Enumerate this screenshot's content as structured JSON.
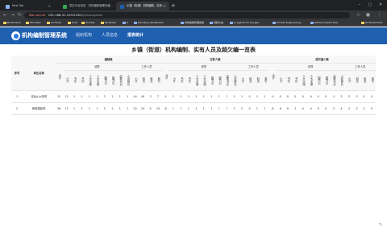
{
  "browser": {
    "tabs": [
      {
        "title": "New Tab",
        "active": false,
        "favicon_color": "#8ab4f8"
      },
      {
        "title": "党办平台信息 - 机构编制管理系统",
        "active": false,
        "favicon_color": "#34a853"
      },
      {
        "title": "乡镇（街道）机构编制、实有...",
        "active": true,
        "favicon_color": "#1f5fb0"
      }
    ],
    "new_tab": "+",
    "window_controls": [
      "–",
      "▢",
      "✕"
    ],
    "security_label": "Not secure",
    "url_host": "192.168.31.193:5190",
    "url_path": "/tjs/xiangzhen",
    "bookmarks": [
      {
        "label": "Bookmarks",
        "folder": true
      },
      {
        "label": "Favorites",
        "folder": true
      },
      {
        "label": "Archives",
        "folder": true
      },
      {
        "label": "tools",
        "folder": true
      },
      {
        "label": "Zombie",
        "folder": true
      },
      {
        "label": "Facebook",
        "folder": true
      },
      {
        "label": "Z",
        "folder": false
      },
      {
        "label": "Deciding repositories",
        "folder": false
      },
      {
        "label": "机构编制管理系统",
        "folder": false
      },
      {
        "label": "视频小站",
        "folder": false
      },
      {
        "label": "ai agents for Google...",
        "folder": false
      },
      {
        "label": "Prompt Engineering...",
        "folder": false
      },
      {
        "label": "GitHub Copilot Sea...",
        "folder": false
      }
    ],
    "all_bookmarks": "All Bookmarks"
  },
  "app": {
    "title": "机构编制管理系统",
    "menu": [
      {
        "label": "组织机构",
        "active": false
      },
      {
        "label": "人员信息",
        "active": false
      },
      {
        "label": "报表统计",
        "active": true
      }
    ]
  },
  "report": {
    "title": "乡镇（街道）机构编制、实有人员及超欠编一览表",
    "headers": {
      "seq": "序号",
      "unit": "单位名称",
      "groups": [
        "编制数",
        "在职人数",
        "超欠编人数"
      ],
      "leader": "领导",
      "staff": "工作人员",
      "total": "合计",
      "small": "小计",
      "leader_cols": [
        "书记",
        "人大主席",
        "副书记",
        "纪委书记",
        "人武部长"
      ],
      "staff_cols": [
        "小计",
        "科员",
        "其它"
      ]
    },
    "rows": [
      {
        "seq": "1",
        "name": "佳龙乡乡政府",
        "bz": [
          "12",
          "12",
          "1",
          "1",
          "1",
          "1",
          "2",
          "1",
          "1",
          "1",
          "44",
          "40",
          "3",
          "7"
        ],
        "zz": [
          "4",
          "1",
          "1",
          "1",
          "1",
          "1",
          "1",
          "1",
          "1",
          "1",
          "1",
          "0",
          "1",
          "1"
        ],
        "cq": [
          "-4",
          "-4",
          "0",
          "0",
          "0",
          "-4",
          "0",
          "0",
          "-1",
          "-3",
          "-3",
          "-3",
          "0",
          "0"
        ]
      },
      {
        "seq": "2",
        "name": "和睦镇政府",
        "bz": [
          "36",
          "12",
          "1",
          "1",
          "1",
          "1",
          "5",
          "1",
          "1",
          "1",
          "24",
          "24",
          "0",
          "10"
        ],
        "zz": [
          "6",
          "1",
          "1",
          "1",
          "1",
          "1",
          "1",
          "1",
          "1",
          "2",
          "2",
          "0",
          "1",
          "1"
        ],
        "cq": [
          "-6",
          "-6",
          "0",
          "1",
          "0",
          "-4",
          "0",
          "0",
          "-2",
          "-4",
          "-3",
          "-3",
          "-1",
          "0"
        ]
      }
    ]
  }
}
